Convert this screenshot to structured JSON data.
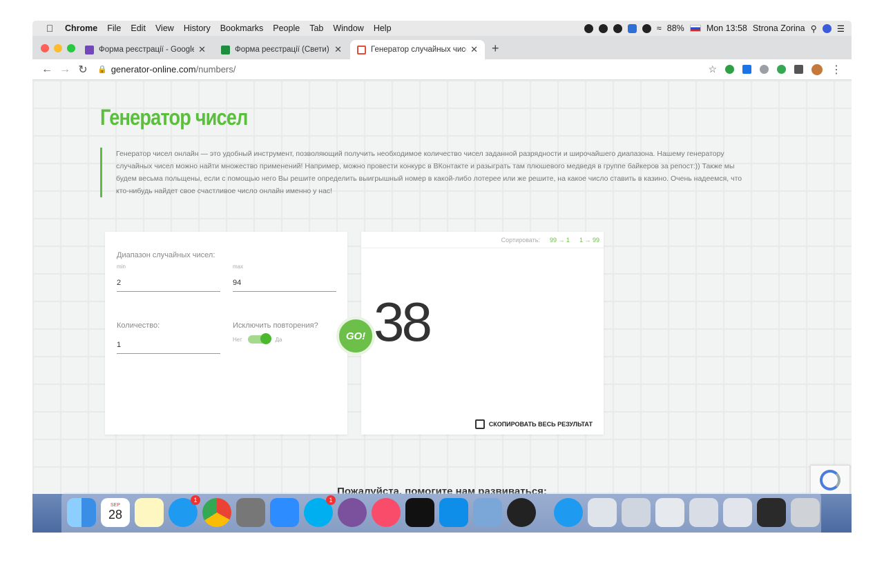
{
  "menubar": {
    "apple": "",
    "app": "Chrome",
    "items": [
      "File",
      "Edit",
      "View",
      "History",
      "Bookmarks",
      "People",
      "Tab",
      "Window",
      "Help"
    ],
    "battery": "88%",
    "clock": "Mon 13:58",
    "user": "Strona Zorina"
  },
  "tabs": [
    {
      "title": "Форма реєстрації - Google Ф",
      "icon": "forms-icon",
      "color": "#7248b9"
    },
    {
      "title": "Форма реєстрації (Свети) -",
      "icon": "classroom-icon",
      "color": "#1e8e3e"
    },
    {
      "title": "Генератор случайных чисел с",
      "icon": "generator-icon",
      "color": "#e04e39"
    }
  ],
  "address": {
    "host": "generator-online.com",
    "path": "/numbers/"
  },
  "page": {
    "title": "Генератор чисел",
    "intro": "Генератор чисел онлайн — это удобный инструмент, позволяющий получить необходимое количество чисел заданной разрядности и широчайшего диапазона. Нашему генератору случайных чисел можно найти множество применений! Например, можно провести конкурс в ВКонтакте и разыграть там плюшевого медведя в группе байкеров за репост:)) Также мы будем весьма польщены, если с помощью него Вы решите определить выигрышный номер в какой-либо лотерее или же решите, на какое число ставить в казино. Очень надеемся, что кто-нибудь найдет свое счастливое число онлайн именно у нас!",
    "range_label": "Диапазон случайных чисел:",
    "min_label": "min",
    "max_label": "max",
    "min_value": "2",
    "max_value": "94",
    "count_label": "Количество:",
    "count_value": "1",
    "exclude_label": "Исключить повторения?",
    "toggle_off": "Нет",
    "toggle_on": "Да",
    "go_label": "GO!",
    "sort_label": "Сортировать:",
    "sort_desc": "99 → 1",
    "sort_asc": "1 → 99",
    "result": "38",
    "copy_label": "СКОПИРОВАТЬ ВЕСЬ РЕЗУЛЬТАТ",
    "help_title": "Пожалуйста, помогите нам развиваться:"
  },
  "dock": {
    "calendar_month": "SEP",
    "calendar_day": "28",
    "badge_count": "1"
  },
  "colors": {
    "accent": "#5cbe3e",
    "dock": "#5877ad"
  }
}
